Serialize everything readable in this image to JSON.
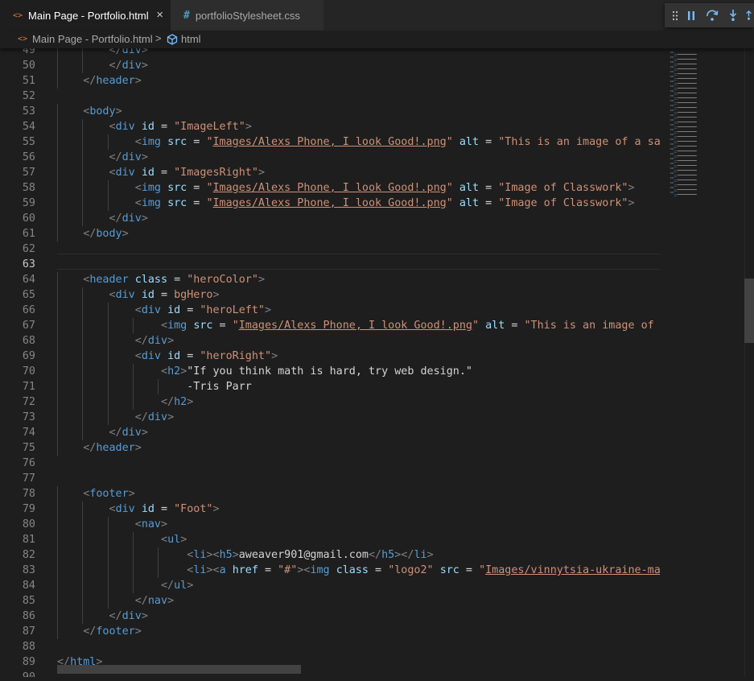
{
  "tabs": [
    {
      "label": "Main Page - Portfolio.html",
      "icon": "html-file-icon",
      "icon_glyph": "<>",
      "active": true,
      "close": "×"
    },
    {
      "label": "portfolioStylesheet.css",
      "icon": "css-file-icon",
      "icon_glyph": "#",
      "active": false
    }
  ],
  "debug_toolbar": [
    "drag-handle-icon",
    "pause-icon",
    "step-over-icon",
    "step-into-icon",
    "step-out-icon"
  ],
  "breadcrumb": {
    "file": "Main Page - Portfolio.html",
    "separator": ">",
    "element": "html"
  },
  "editor": {
    "current_line": 63,
    "lines": [
      {
        "n": "49",
        "i": 2,
        "seg": [
          [
            "tb",
            "</"
          ],
          [
            "t",
            "div"
          ],
          [
            "tb",
            ">"
          ]
        ]
      },
      {
        "n": "50",
        "i": 2,
        "seg": [
          [
            "tb",
            "</"
          ],
          [
            "t",
            "div"
          ],
          [
            "tb",
            ">"
          ]
        ]
      },
      {
        "n": "51",
        "i": 1,
        "seg": [
          [
            "tb",
            "</"
          ],
          [
            "t",
            "header"
          ],
          [
            "tb",
            ">"
          ]
        ]
      },
      {
        "n": "52",
        "i": 0,
        "seg": []
      },
      {
        "n": "53",
        "i": 1,
        "seg": [
          [
            "tb",
            "<"
          ],
          [
            "t",
            "body"
          ],
          [
            "tb",
            ">"
          ]
        ]
      },
      {
        "n": "54",
        "i": 2,
        "seg": [
          [
            "tb",
            "<"
          ],
          [
            "t",
            "div"
          ],
          [
            "p",
            " "
          ],
          [
            "a",
            "id"
          ],
          [
            "p",
            " = "
          ],
          [
            "s",
            "\"ImageLeft\""
          ],
          [
            "tb",
            ">"
          ]
        ]
      },
      {
        "n": "55",
        "i": 3,
        "seg": [
          [
            "tb",
            "<"
          ],
          [
            "t",
            "img"
          ],
          [
            "p",
            " "
          ],
          [
            "a",
            "src"
          ],
          [
            "p",
            " = "
          ],
          [
            "s",
            "\""
          ],
          [
            "su",
            "Images/Alexs Phone, I look Good!.png"
          ],
          [
            "s",
            "\""
          ],
          [
            "p",
            " "
          ],
          [
            "a",
            "alt"
          ],
          [
            "p",
            " = "
          ],
          [
            "s",
            "\"This is an image of a sample"
          ]
        ]
      },
      {
        "n": "56",
        "i": 2,
        "seg": [
          [
            "tb",
            "</"
          ],
          [
            "t",
            "div"
          ],
          [
            "tb",
            ">"
          ]
        ]
      },
      {
        "n": "57",
        "i": 2,
        "seg": [
          [
            "tb",
            "<"
          ],
          [
            "t",
            "div"
          ],
          [
            "p",
            " "
          ],
          [
            "a",
            "id"
          ],
          [
            "p",
            " = "
          ],
          [
            "s",
            "\"ImagesRight\""
          ],
          [
            "tb",
            ">"
          ]
        ]
      },
      {
        "n": "58",
        "i": 3,
        "seg": [
          [
            "tb",
            "<"
          ],
          [
            "t",
            "img"
          ],
          [
            "p",
            " "
          ],
          [
            "a",
            "src"
          ],
          [
            "p",
            " = "
          ],
          [
            "s",
            "\""
          ],
          [
            "su",
            "Images/Alexs Phone, I look Good!.png"
          ],
          [
            "s",
            "\""
          ],
          [
            "p",
            " "
          ],
          [
            "a",
            "alt"
          ],
          [
            "p",
            " = "
          ],
          [
            "s",
            "\"Image of Classwork\""
          ],
          [
            "tb",
            ">"
          ]
        ]
      },
      {
        "n": "59",
        "i": 3,
        "seg": [
          [
            "tb",
            "<"
          ],
          [
            "t",
            "img"
          ],
          [
            "p",
            " "
          ],
          [
            "a",
            "src"
          ],
          [
            "p",
            " = "
          ],
          [
            "s",
            "\""
          ],
          [
            "su",
            "Images/Alexs Phone, I look Good!.png"
          ],
          [
            "s",
            "\""
          ],
          [
            "p",
            " "
          ],
          [
            "a",
            "alt"
          ],
          [
            "p",
            " = "
          ],
          [
            "s",
            "\"Image of Classwork\""
          ],
          [
            "tb",
            ">"
          ]
        ]
      },
      {
        "n": "60",
        "i": 2,
        "seg": [
          [
            "tb",
            "</"
          ],
          [
            "t",
            "div"
          ],
          [
            "tb",
            ">"
          ]
        ]
      },
      {
        "n": "61",
        "i": 1,
        "seg": [
          [
            "tb",
            "</"
          ],
          [
            "t",
            "body"
          ],
          [
            "tb",
            ">"
          ]
        ]
      },
      {
        "n": "62",
        "i": 0,
        "seg": []
      },
      {
        "n": "63",
        "i": 0,
        "seg": []
      },
      {
        "n": "64",
        "i": 1,
        "seg": [
          [
            "tb",
            "<"
          ],
          [
            "t",
            "header"
          ],
          [
            "p",
            " "
          ],
          [
            "a",
            "class"
          ],
          [
            "p",
            " = "
          ],
          [
            "s",
            "\"heroColor\""
          ],
          [
            "tb",
            ">"
          ]
        ]
      },
      {
        "n": "65",
        "i": 2,
        "seg": [
          [
            "tb",
            "<"
          ],
          [
            "t",
            "div"
          ],
          [
            "p",
            " "
          ],
          [
            "a",
            "id"
          ],
          [
            "p",
            " = "
          ],
          [
            "s",
            "bgHero"
          ],
          [
            "tb",
            ">"
          ]
        ]
      },
      {
        "n": "66",
        "i": 3,
        "seg": [
          [
            "tb",
            "<"
          ],
          [
            "t",
            "div"
          ],
          [
            "p",
            " "
          ],
          [
            "a",
            "id"
          ],
          [
            "p",
            " = "
          ],
          [
            "s",
            "\"heroLeft\""
          ],
          [
            "tb",
            ">"
          ]
        ]
      },
      {
        "n": "67",
        "i": 4,
        "seg": [
          [
            "tb",
            "<"
          ],
          [
            "t",
            "img"
          ],
          [
            "p",
            " "
          ],
          [
            "a",
            "src"
          ],
          [
            "p",
            " = "
          ],
          [
            "s",
            "\""
          ],
          [
            "su",
            "Images/Alexs Phone, I look Good!.png"
          ],
          [
            "s",
            "\""
          ],
          [
            "p",
            " "
          ],
          [
            "a",
            "alt"
          ],
          [
            "p",
            " = "
          ],
          [
            "s",
            "\"This is an image of a sa"
          ]
        ]
      },
      {
        "n": "68",
        "i": 3,
        "seg": [
          [
            "tb",
            "</"
          ],
          [
            "t",
            "div"
          ],
          [
            "tb",
            ">"
          ]
        ]
      },
      {
        "n": "69",
        "i": 3,
        "seg": [
          [
            "tb",
            "<"
          ],
          [
            "t",
            "div"
          ],
          [
            "p",
            " "
          ],
          [
            "a",
            "id"
          ],
          [
            "p",
            " = "
          ],
          [
            "s",
            "\"heroRight\""
          ],
          [
            "tb",
            ">"
          ]
        ]
      },
      {
        "n": "70",
        "i": 4,
        "seg": [
          [
            "tb",
            "<"
          ],
          [
            "t",
            "h2"
          ],
          [
            "tb",
            ">"
          ],
          [
            "p",
            "\"If you think math is hard, try web design.\""
          ]
        ]
      },
      {
        "n": "71",
        "i": 5,
        "seg": [
          [
            "p",
            "-Tris Parr"
          ]
        ]
      },
      {
        "n": "72",
        "i": 4,
        "seg": [
          [
            "tb",
            "</"
          ],
          [
            "t",
            "h2"
          ],
          [
            "tb",
            ">"
          ]
        ]
      },
      {
        "n": "73",
        "i": 3,
        "seg": [
          [
            "tb",
            "</"
          ],
          [
            "t",
            "div"
          ],
          [
            "tb",
            ">"
          ]
        ]
      },
      {
        "n": "74",
        "i": 2,
        "seg": [
          [
            "tb",
            "</"
          ],
          [
            "t",
            "div"
          ],
          [
            "tb",
            ">"
          ]
        ]
      },
      {
        "n": "75",
        "i": 1,
        "seg": [
          [
            "tb",
            "</"
          ],
          [
            "t",
            "header"
          ],
          [
            "tb",
            ">"
          ]
        ]
      },
      {
        "n": "76",
        "i": 0,
        "seg": []
      },
      {
        "n": "77",
        "i": 0,
        "seg": []
      },
      {
        "n": "78",
        "i": 1,
        "seg": [
          [
            "tb",
            "<"
          ],
          [
            "t",
            "footer"
          ],
          [
            "tb",
            ">"
          ]
        ]
      },
      {
        "n": "79",
        "i": 2,
        "seg": [
          [
            "tb",
            "<"
          ],
          [
            "t",
            "div"
          ],
          [
            "p",
            " "
          ],
          [
            "a",
            "id"
          ],
          [
            "p",
            " = "
          ],
          [
            "s",
            "\"Foot\""
          ],
          [
            "tb",
            ">"
          ]
        ]
      },
      {
        "n": "80",
        "i": 3,
        "seg": [
          [
            "tb",
            "<"
          ],
          [
            "t",
            "nav"
          ],
          [
            "tb",
            ">"
          ]
        ]
      },
      {
        "n": "81",
        "i": 4,
        "seg": [
          [
            "tb",
            "<"
          ],
          [
            "t",
            "ul"
          ],
          [
            "tb",
            ">"
          ]
        ]
      },
      {
        "n": "82",
        "i": 5,
        "seg": [
          [
            "tb",
            "<"
          ],
          [
            "t",
            "li"
          ],
          [
            "tb",
            "><"
          ],
          [
            "t",
            "h5"
          ],
          [
            "tb",
            ">"
          ],
          [
            "p",
            "aweaver901@gmail.com"
          ],
          [
            "tb",
            "</"
          ],
          [
            "t",
            "h5"
          ],
          [
            "tb",
            "></"
          ],
          [
            "t",
            "li"
          ],
          [
            "tb",
            ">"
          ]
        ]
      },
      {
        "n": "83",
        "i": 5,
        "seg": [
          [
            "tb",
            "<"
          ],
          [
            "t",
            "li"
          ],
          [
            "tb",
            "><"
          ],
          [
            "t",
            "a"
          ],
          [
            "p",
            " "
          ],
          [
            "a",
            "href"
          ],
          [
            "p",
            " = "
          ],
          [
            "s",
            "\"#\""
          ],
          [
            "tb",
            "><"
          ],
          [
            "t",
            "img"
          ],
          [
            "p",
            " "
          ],
          [
            "a",
            "class"
          ],
          [
            "p",
            " = "
          ],
          [
            "s",
            "\"logo2\""
          ],
          [
            "p",
            " "
          ],
          [
            "a",
            "src"
          ],
          [
            "p",
            " = "
          ],
          [
            "s",
            "\""
          ],
          [
            "su",
            "Images/vinnytsia-ukraine-may-se"
          ]
        ]
      },
      {
        "n": "84",
        "i": 4,
        "seg": [
          [
            "tb",
            "</"
          ],
          [
            "t",
            "ul"
          ],
          [
            "tb",
            ">"
          ]
        ]
      },
      {
        "n": "85",
        "i": 3,
        "seg": [
          [
            "tb",
            "</"
          ],
          [
            "t",
            "nav"
          ],
          [
            "tb",
            ">"
          ]
        ]
      },
      {
        "n": "86",
        "i": 2,
        "seg": [
          [
            "tb",
            "</"
          ],
          [
            "t",
            "div"
          ],
          [
            "tb",
            ">"
          ]
        ]
      },
      {
        "n": "87",
        "i": 1,
        "seg": [
          [
            "tb",
            "</"
          ],
          [
            "t",
            "footer"
          ],
          [
            "tb",
            ">"
          ]
        ]
      },
      {
        "n": "88",
        "i": 0,
        "seg": []
      },
      {
        "n": "89",
        "i": 0,
        "seg": [
          [
            "tb",
            "</"
          ],
          [
            "t",
            "html"
          ],
          [
            "tb",
            ">"
          ]
        ]
      },
      {
        "n": "90",
        "i": 0,
        "seg": []
      }
    ]
  },
  "colors": {
    "background": "#1e1e1e",
    "tag": "#569cd6",
    "attribute": "#9cdcfe",
    "string": "#ce9178",
    "text": "#d4d4d4",
    "bracket": "#808080",
    "line_number": "#858585"
  }
}
